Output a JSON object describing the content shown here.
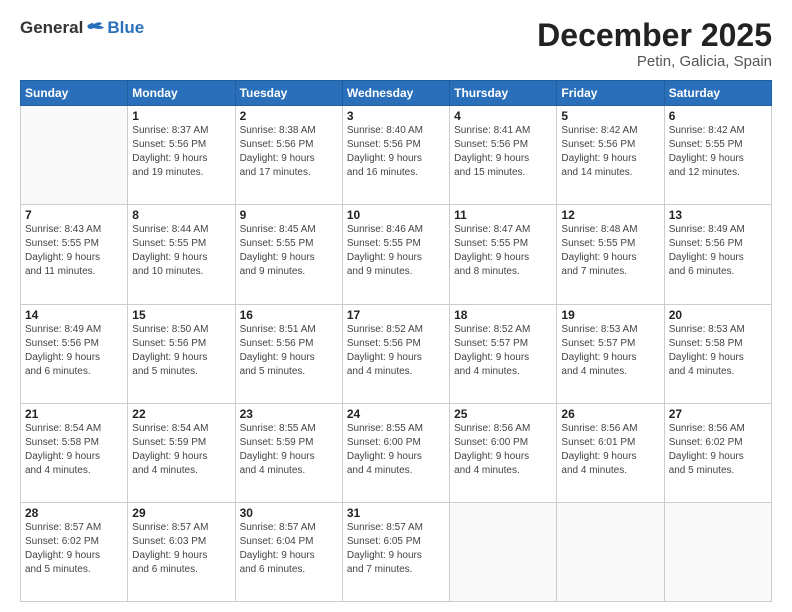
{
  "header": {
    "logo_general": "General",
    "logo_blue": "Blue",
    "month_title": "December 2025",
    "location": "Petin, Galicia, Spain"
  },
  "weekdays": [
    "Sunday",
    "Monday",
    "Tuesday",
    "Wednesday",
    "Thursday",
    "Friday",
    "Saturday"
  ],
  "weeks": [
    [
      {
        "day": "",
        "info": ""
      },
      {
        "day": "1",
        "info": "Sunrise: 8:37 AM\nSunset: 5:56 PM\nDaylight: 9 hours\nand 19 minutes."
      },
      {
        "day": "2",
        "info": "Sunrise: 8:38 AM\nSunset: 5:56 PM\nDaylight: 9 hours\nand 17 minutes."
      },
      {
        "day": "3",
        "info": "Sunrise: 8:40 AM\nSunset: 5:56 PM\nDaylight: 9 hours\nand 16 minutes."
      },
      {
        "day": "4",
        "info": "Sunrise: 8:41 AM\nSunset: 5:56 PM\nDaylight: 9 hours\nand 15 minutes."
      },
      {
        "day": "5",
        "info": "Sunrise: 8:42 AM\nSunset: 5:56 PM\nDaylight: 9 hours\nand 14 minutes."
      },
      {
        "day": "6",
        "info": "Sunrise: 8:42 AM\nSunset: 5:55 PM\nDaylight: 9 hours\nand 12 minutes."
      }
    ],
    [
      {
        "day": "7",
        "info": "Sunrise: 8:43 AM\nSunset: 5:55 PM\nDaylight: 9 hours\nand 11 minutes."
      },
      {
        "day": "8",
        "info": "Sunrise: 8:44 AM\nSunset: 5:55 PM\nDaylight: 9 hours\nand 10 minutes."
      },
      {
        "day": "9",
        "info": "Sunrise: 8:45 AM\nSunset: 5:55 PM\nDaylight: 9 hours\nand 9 minutes."
      },
      {
        "day": "10",
        "info": "Sunrise: 8:46 AM\nSunset: 5:55 PM\nDaylight: 9 hours\nand 9 minutes."
      },
      {
        "day": "11",
        "info": "Sunrise: 8:47 AM\nSunset: 5:55 PM\nDaylight: 9 hours\nand 8 minutes."
      },
      {
        "day": "12",
        "info": "Sunrise: 8:48 AM\nSunset: 5:55 PM\nDaylight: 9 hours\nand 7 minutes."
      },
      {
        "day": "13",
        "info": "Sunrise: 8:49 AM\nSunset: 5:56 PM\nDaylight: 9 hours\nand 6 minutes."
      }
    ],
    [
      {
        "day": "14",
        "info": "Sunrise: 8:49 AM\nSunset: 5:56 PM\nDaylight: 9 hours\nand 6 minutes."
      },
      {
        "day": "15",
        "info": "Sunrise: 8:50 AM\nSunset: 5:56 PM\nDaylight: 9 hours\nand 5 minutes."
      },
      {
        "day": "16",
        "info": "Sunrise: 8:51 AM\nSunset: 5:56 PM\nDaylight: 9 hours\nand 5 minutes."
      },
      {
        "day": "17",
        "info": "Sunrise: 8:52 AM\nSunset: 5:56 PM\nDaylight: 9 hours\nand 4 minutes."
      },
      {
        "day": "18",
        "info": "Sunrise: 8:52 AM\nSunset: 5:57 PM\nDaylight: 9 hours\nand 4 minutes."
      },
      {
        "day": "19",
        "info": "Sunrise: 8:53 AM\nSunset: 5:57 PM\nDaylight: 9 hours\nand 4 minutes."
      },
      {
        "day": "20",
        "info": "Sunrise: 8:53 AM\nSunset: 5:58 PM\nDaylight: 9 hours\nand 4 minutes."
      }
    ],
    [
      {
        "day": "21",
        "info": "Sunrise: 8:54 AM\nSunset: 5:58 PM\nDaylight: 9 hours\nand 4 minutes."
      },
      {
        "day": "22",
        "info": "Sunrise: 8:54 AM\nSunset: 5:59 PM\nDaylight: 9 hours\nand 4 minutes."
      },
      {
        "day": "23",
        "info": "Sunrise: 8:55 AM\nSunset: 5:59 PM\nDaylight: 9 hours\nand 4 minutes."
      },
      {
        "day": "24",
        "info": "Sunrise: 8:55 AM\nSunset: 6:00 PM\nDaylight: 9 hours\nand 4 minutes."
      },
      {
        "day": "25",
        "info": "Sunrise: 8:56 AM\nSunset: 6:00 PM\nDaylight: 9 hours\nand 4 minutes."
      },
      {
        "day": "26",
        "info": "Sunrise: 8:56 AM\nSunset: 6:01 PM\nDaylight: 9 hours\nand 4 minutes."
      },
      {
        "day": "27",
        "info": "Sunrise: 8:56 AM\nSunset: 6:02 PM\nDaylight: 9 hours\nand 5 minutes."
      }
    ],
    [
      {
        "day": "28",
        "info": "Sunrise: 8:57 AM\nSunset: 6:02 PM\nDaylight: 9 hours\nand 5 minutes."
      },
      {
        "day": "29",
        "info": "Sunrise: 8:57 AM\nSunset: 6:03 PM\nDaylight: 9 hours\nand 6 minutes."
      },
      {
        "day": "30",
        "info": "Sunrise: 8:57 AM\nSunset: 6:04 PM\nDaylight: 9 hours\nand 6 minutes."
      },
      {
        "day": "31",
        "info": "Sunrise: 8:57 AM\nSunset: 6:05 PM\nDaylight: 9 hours\nand 7 minutes."
      },
      {
        "day": "",
        "info": ""
      },
      {
        "day": "",
        "info": ""
      },
      {
        "day": "",
        "info": ""
      }
    ]
  ]
}
